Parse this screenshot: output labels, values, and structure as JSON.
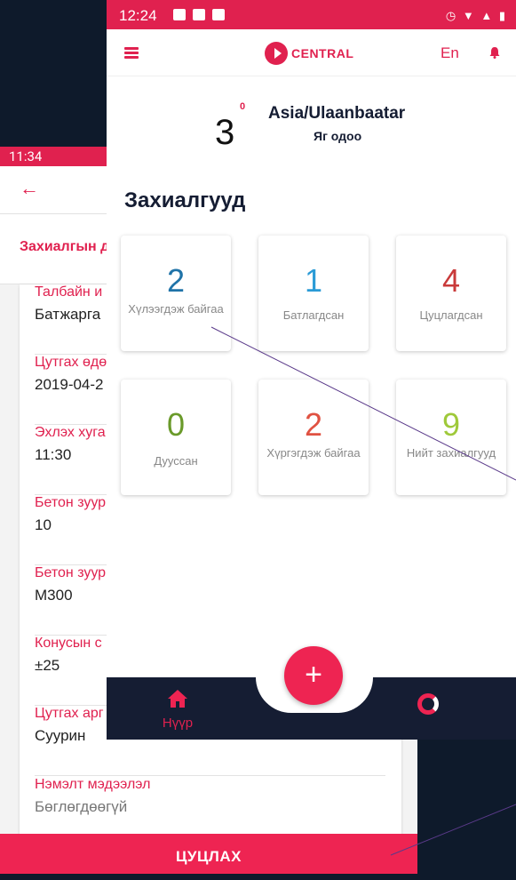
{
  "background_screen": {
    "status_time": "11:34",
    "tab_label": "Захиалгын д",
    "fields": [
      {
        "label": "Талбайн и",
        "value": "Батжарга"
      },
      {
        "label": "Цутгах өдө",
        "value": "2019-04-2"
      },
      {
        "label": "Эхлэх хуга",
        "value": "11:30"
      },
      {
        "label": "Бетон зуур",
        "value": "10"
      },
      {
        "label": "Бетон зуур",
        "value": "M300"
      },
      {
        "label": "Конусын с",
        "value": "±25"
      },
      {
        "label": "Цутгах арг",
        "value": "Суурин"
      },
      {
        "label": "Нэмэлт мэдээлэл",
        "value": "Бөглөгдөөгүй"
      }
    ],
    "cancel_button": "ЦУЦЛАХ"
  },
  "foreground_screen": {
    "status_time": "12:24",
    "logo_text": "CENTRAL",
    "language": "En",
    "weather": {
      "temp": "3",
      "deg": "0",
      "city": "Asia/Ulaanbaatar",
      "sub": "Яг одоо"
    },
    "section_title": "Захиалгууд",
    "stats": [
      {
        "num": "2",
        "label": "Хүлээгдэж байгаа",
        "color": "#1f73a8"
      },
      {
        "num": "1",
        "label": "Батлагдсан",
        "color": "#2a9bd6"
      },
      {
        "num": "4",
        "label": "Цуцлагдсан",
        "color": "#c93a3a"
      },
      {
        "num": "0",
        "label": "Дууссан",
        "color": "#6a9a2a"
      },
      {
        "num": "2",
        "label": "Хүргэгдэж байгаа",
        "color": "#e05242"
      },
      {
        "num": "9",
        "label": "Нийт захиалгууд",
        "color": "#9fc93a"
      }
    ],
    "nav": {
      "home_label": "Нүүр",
      "fab_label": "+"
    }
  },
  "colors": {
    "accent": "#e0214f",
    "navy": "#151d33",
    "background": "#0e1a2b"
  }
}
